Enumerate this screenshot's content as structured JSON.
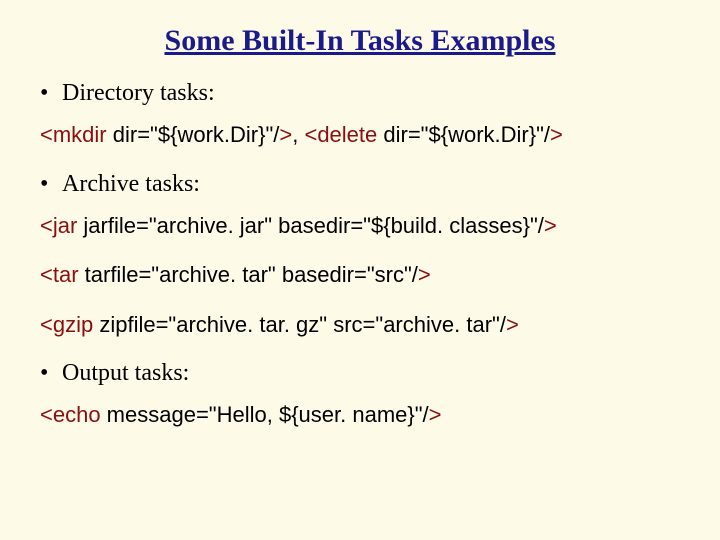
{
  "title": "Some Built-In Tasks Examples",
  "sections": [
    {
      "bullet": "Directory tasks:",
      "code_lines": [
        [
          {
            "tag": true,
            "text": "<mkdir "
          },
          {
            "tag": false,
            "text": "dir=\"${work.Dir}\"/"
          },
          {
            "tag": true,
            "text": ">"
          },
          {
            "tag": false,
            "text": ", "
          },
          {
            "tag": true,
            "text": "<delete "
          },
          {
            "tag": false,
            "text": "dir=\"${work.Dir}\"/"
          },
          {
            "tag": true,
            "text": ">"
          }
        ]
      ]
    },
    {
      "bullet": "Archive tasks:",
      "code_lines": [
        [
          {
            "tag": true,
            "text": "<jar "
          },
          {
            "tag": false,
            "text": "jarfile=\"archive. jar\" basedir=\"${build. classes}\"/"
          },
          {
            "tag": true,
            "text": ">"
          }
        ],
        [
          {
            "tag": true,
            "text": "<tar "
          },
          {
            "tag": false,
            "text": "tarfile=\"archive. tar\" basedir=\"src\"/"
          },
          {
            "tag": true,
            "text": ">"
          }
        ],
        [
          {
            "tag": true,
            "text": "<gzip "
          },
          {
            "tag": false,
            "text": "zipfile=\"archive. tar. gz\" src=\"archive. tar\"/"
          },
          {
            "tag": true,
            "text": ">"
          }
        ]
      ]
    },
    {
      "bullet": "Output tasks:",
      "code_lines": [
        [
          {
            "tag": true,
            "text": "<echo "
          },
          {
            "tag": false,
            "text": "message=\"Hello, ${user. name}\"/"
          },
          {
            "tag": true,
            "text": ">"
          }
        ]
      ]
    }
  ]
}
